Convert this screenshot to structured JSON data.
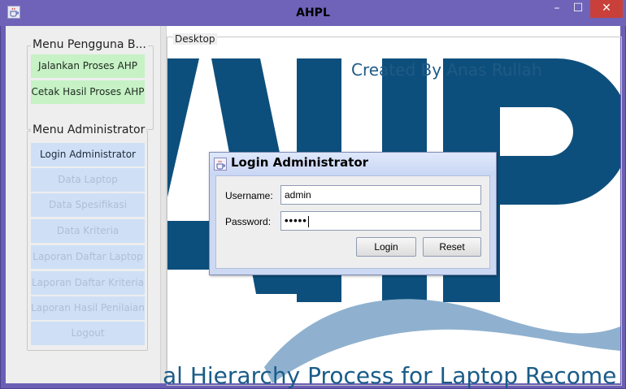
{
  "window": {
    "title": "AHPL",
    "minimize_glyph": "–",
    "maximize_glyph": "☐",
    "close_glyph": "✕",
    "close_color": "#c9403a",
    "title_bar_color": "#6e63b8"
  },
  "menu_user": {
    "title": "Menu Pengguna B...",
    "items": [
      {
        "label": "Jalankan Proses AHP",
        "state": "enabled"
      },
      {
        "label": "Cetak Hasil Proses AHP",
        "state": "enabled"
      }
    ]
  },
  "menu_admin": {
    "title": "Menu Administrator",
    "items": [
      {
        "label": "Login Administrator",
        "state": "enabled"
      },
      {
        "label": "Data Laptop",
        "state": "disabled"
      },
      {
        "label": "Data Spesifikasi",
        "state": "disabled"
      },
      {
        "label": "Data Kriteria",
        "state": "disabled"
      },
      {
        "label": "Laporan Daftar Laptop",
        "state": "disabled"
      },
      {
        "label": "Laporan Daftar Kriteria",
        "state": "disabled"
      },
      {
        "label": "Laporan Hasil Penilaian",
        "state": "disabled"
      },
      {
        "label": "Logout",
        "state": "disabled"
      }
    ]
  },
  "desktop": {
    "title": "Desktop",
    "created_by": "Created By Anas Rullah",
    "bottom_text": "al Hierarchy Process for Laptop Recome",
    "logo_text": "AHP",
    "brand_color": "#0d4f7c",
    "wave_color": "#8fb1cf"
  },
  "login_dialog": {
    "title": "Login Administrator",
    "username_label": "Username:",
    "username_value": "admin",
    "password_label": "Password:",
    "password_value": "•••••",
    "login_button": "Login",
    "reset_button": "Reset"
  },
  "icons": {
    "app_icon": "java-coffee-icon",
    "dialog_icon": "java-coffee-icon"
  }
}
